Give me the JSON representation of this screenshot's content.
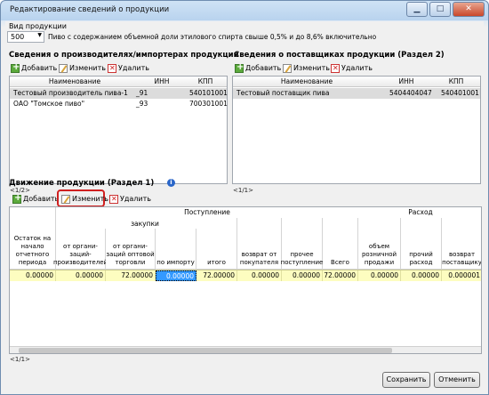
{
  "window": {
    "title": "Редактирование сведений о продукции",
    "btn_minimize": "▁",
    "btn_maximize": "□",
    "btn_close": "✕"
  },
  "product": {
    "label": "Вид продукции",
    "code": "500",
    "description": "Пиво с содержанием объемной доли этилового спирта свыше 0,5% и до 8,6% включительно"
  },
  "producers": {
    "title": "Сведения о производителях/импортерах продукции",
    "toolbar": {
      "add": "Добавить",
      "edit": "Изменить",
      "delete": "Удалить"
    },
    "columns": [
      "Наименование",
      "ИНН",
      "КПП"
    ],
    "rows": [
      {
        "name": "Тестовый производитель пива-1",
        "inn": "_91",
        "kpp": "540101001"
      },
      {
        "name": "ОАО \"Томское пиво\"",
        "inn": "_93",
        "kpp": "700301001"
      }
    ],
    "pager": "<1/2>"
  },
  "suppliers": {
    "title": "Сведения о поставщиках продукции (Раздел 2)",
    "toolbar": {
      "add": "Добавить",
      "edit": "Изменить",
      "delete": "Удалить"
    },
    "columns": [
      "Наименование",
      "ИНН",
      "КПП"
    ],
    "rows": [
      {
        "name": "Тестовый поставщик пива",
        "inn": "5404404047",
        "kpp": "540401001"
      }
    ],
    "pager": "<1/1>"
  },
  "movement": {
    "title": "Движение продукции (Раздел 1)",
    "toolbar": {
      "add": "Добавить",
      "edit": "Изменить",
      "delete": "Удалить"
    },
    "group_income": "Поступление",
    "group_purchases": "закупки",
    "group_expense": "Расход",
    "columns": [
      "Остаток на начало отчетного периода",
      "от органи-заций-производителей",
      "от органи-заций оптовой торговли",
      "по импорту",
      "итого",
      "возврат от покупателя",
      "прочее поступление",
      "Всего",
      "объем розничной продажи",
      "прочий расход",
      "возврат поставщику"
    ],
    "values": [
      "0.00000",
      "0.00000",
      "72.00000",
      "0.00000",
      "72.00000",
      "0.00000",
      "0.00000",
      "72.00000",
      "0.00000",
      "0.00000",
      "0.000001"
    ],
    "pager": "<1/1>"
  },
  "footer": {
    "save": "Сохранить",
    "cancel": "Отменить"
  },
  "colors": {
    "highlight_box": "#d02020",
    "row_yellow": "#fdfdc0",
    "selected_cell": "#3399ff"
  }
}
